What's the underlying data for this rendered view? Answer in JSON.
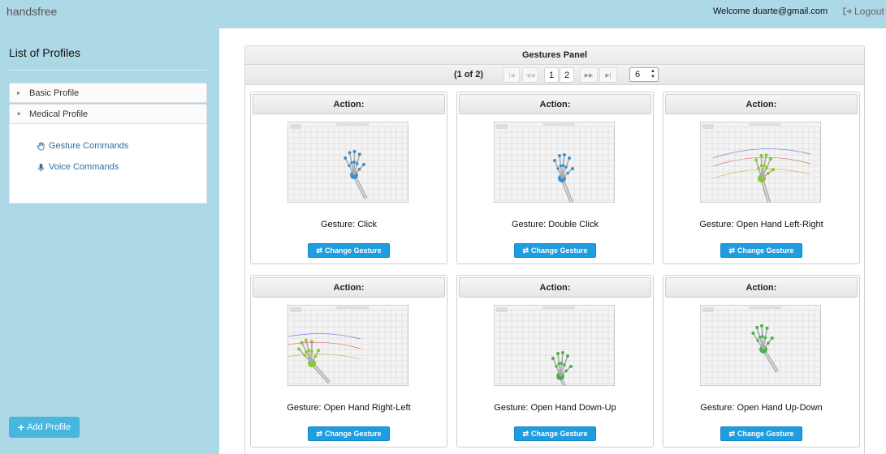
{
  "header": {
    "brand": "handsfree",
    "welcome": "Welcome duarte@gmail.com",
    "logout_label": "Logout"
  },
  "sidebar": {
    "title": "List of Profiles",
    "profiles": [
      {
        "label": "Basic Profile",
        "expanded": false
      },
      {
        "label": "Medical Profile",
        "expanded": true,
        "links": [
          {
            "label": "Gesture Commands",
            "icon": "hand-icon"
          },
          {
            "label": "Voice Commands",
            "icon": "microphone-icon"
          }
        ]
      }
    ],
    "add_profile_label": "Add Profile"
  },
  "panel": {
    "title": "Gestures Panel",
    "paginator": {
      "current": "(1 of 2)",
      "pages": [
        "1",
        "2"
      ],
      "rows_per_page": "6"
    },
    "cards": [
      {
        "action_label": "Action:",
        "gesture": "Gesture: Click",
        "button": "Change Gesture"
      },
      {
        "action_label": "Action:",
        "gesture": "Gesture: Double Click",
        "button": "Change Gesture"
      },
      {
        "action_label": "Action:",
        "gesture": "Gesture: Open Hand Left-Right",
        "button": "Change Gesture"
      },
      {
        "action_label": "Action:",
        "gesture": "Gesture: Open Hand Right-Left",
        "button": "Change Gesture"
      },
      {
        "action_label": "Action:",
        "gesture": "Gesture: Open Hand Down-Up",
        "button": "Change Gesture"
      },
      {
        "action_label": "Action:",
        "gesture": "Gesture: Open Hand Up-Down",
        "button": "Change Gesture"
      }
    ]
  },
  "colors": {
    "background": "#add8e6",
    "accent": "#1e9de0",
    "add_button": "#49b6e0"
  }
}
